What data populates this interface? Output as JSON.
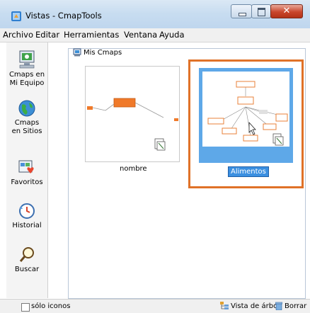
{
  "window": {
    "title": "Vistas - CmapTools"
  },
  "menu": [
    "Archivo",
    "Editar",
    "Herramientas",
    "Ventana",
    "Ayuda"
  ],
  "nav": [
    {
      "label": "Cmaps en Mi Equipo",
      "line1": "Cmaps en",
      "line2": "Mi Equipo",
      "icon": "computer-icon"
    },
    {
      "label": "Cmaps en Sitios",
      "line1": "Cmaps",
      "line2": "en Sitios",
      "icon": "globe-icon"
    },
    {
      "label": "Favoritos",
      "line1": "Favoritos",
      "line2": "",
      "icon": "favorites-icon"
    },
    {
      "label": "Historial",
      "line1": "Historial",
      "line2": "",
      "icon": "history-icon"
    },
    {
      "label": "Buscar",
      "line1": "Buscar",
      "line2": "",
      "icon": "search-icon"
    }
  ],
  "breadcrumb": "Mis Cmaps",
  "cmaps": [
    {
      "name": "nombre",
      "selected": false
    },
    {
      "name": "Alimentos",
      "selected": true
    }
  ],
  "bottom": {
    "checkbox_label": "sólo iconos",
    "tree_view": "Vista de árbol",
    "delete": "Borrar"
  },
  "colors": {
    "accent": "#e07228",
    "selection": "#3b8fe0",
    "node_orange": "#f07a2a"
  }
}
